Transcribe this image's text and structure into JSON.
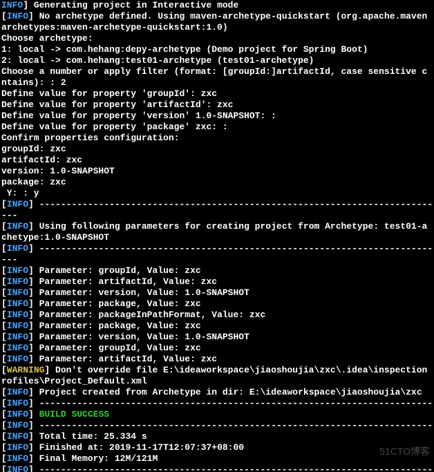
{
  "lines": [
    {
      "segments": [
        {
          "cls": "info",
          "text": "INFO"
        },
        {
          "cls": "white",
          "text": "] Generating project in Interactive mode"
        }
      ],
      "prefix": ""
    },
    {
      "segments": [
        {
          "cls": "white",
          "text": "["
        },
        {
          "cls": "info",
          "text": "INFO"
        },
        {
          "cls": "white",
          "text": "] No archetype defined. Using maven-archetype-quickstart (org.apache.maven"
        }
      ]
    },
    {
      "segments": [
        {
          "cls": "white",
          "text": "archetypes:maven-archetype-quickstart:1.0)"
        }
      ]
    },
    {
      "segments": [
        {
          "cls": "white",
          "text": "Choose archetype:"
        }
      ]
    },
    {
      "segments": [
        {
          "cls": "white",
          "text": "1: local -> com.hehang:depy-archetype (Demo project for Spring Boot)"
        }
      ]
    },
    {
      "segments": [
        {
          "cls": "white",
          "text": "2: local -> com.hehang:test01-archetype (test01-archetype)"
        }
      ]
    },
    {
      "segments": [
        {
          "cls": "white",
          "text": "Choose a number or apply filter (format: [groupId:]artifactId, case sensitive c"
        }
      ]
    },
    {
      "segments": [
        {
          "cls": "white",
          "text": "ntains): : 2"
        }
      ]
    },
    {
      "segments": [
        {
          "cls": "white",
          "text": "Define value for property 'groupId': zxc"
        }
      ]
    },
    {
      "segments": [
        {
          "cls": "white",
          "text": "Define value for property 'artifactId': zxc"
        }
      ]
    },
    {
      "segments": [
        {
          "cls": "white",
          "text": "Define value for property 'version' 1.0-SNAPSHOT: :"
        }
      ]
    },
    {
      "segments": [
        {
          "cls": "white",
          "text": "Define value for property 'package' zxc: :"
        }
      ]
    },
    {
      "segments": [
        {
          "cls": "white",
          "text": "Confirm properties configuration:"
        }
      ]
    },
    {
      "segments": [
        {
          "cls": "white",
          "text": "groupId: zxc"
        }
      ]
    },
    {
      "segments": [
        {
          "cls": "white",
          "text": "artifactId: zxc"
        }
      ]
    },
    {
      "segments": [
        {
          "cls": "white",
          "text": "version: 1.0-SNAPSHOT"
        }
      ]
    },
    {
      "segments": [
        {
          "cls": "white",
          "text": "package: zxc"
        }
      ]
    },
    {
      "segments": [
        {
          "cls": "white",
          "text": " Y: : y"
        }
      ]
    },
    {
      "segments": [
        {
          "cls": "white",
          "text": "["
        },
        {
          "cls": "info",
          "text": "INFO"
        },
        {
          "cls": "white",
          "text": "] -------------------------------------------------------------------------"
        }
      ]
    },
    {
      "segments": [
        {
          "cls": "white",
          "text": "---"
        }
      ]
    },
    {
      "segments": [
        {
          "cls": "white",
          "text": "["
        },
        {
          "cls": "info",
          "text": "INFO"
        },
        {
          "cls": "white",
          "text": "] Using following parameters for creating project from Archetype: test01-a"
        }
      ]
    },
    {
      "segments": [
        {
          "cls": "white",
          "text": "chetype:1.0-SNAPSHOT"
        }
      ]
    },
    {
      "segments": [
        {
          "cls": "white",
          "text": "["
        },
        {
          "cls": "info",
          "text": "INFO"
        },
        {
          "cls": "white",
          "text": "] -------------------------------------------------------------------------"
        }
      ]
    },
    {
      "segments": [
        {
          "cls": "white",
          "text": "---"
        }
      ]
    },
    {
      "segments": [
        {
          "cls": "white",
          "text": "["
        },
        {
          "cls": "info",
          "text": "INFO"
        },
        {
          "cls": "white",
          "text": "] Parameter: groupId, Value: zxc"
        }
      ]
    },
    {
      "segments": [
        {
          "cls": "white",
          "text": "["
        },
        {
          "cls": "info",
          "text": "INFO"
        },
        {
          "cls": "white",
          "text": "] Parameter: artifactId, Value: zxc"
        }
      ]
    },
    {
      "segments": [
        {
          "cls": "white",
          "text": "["
        },
        {
          "cls": "info",
          "text": "INFO"
        },
        {
          "cls": "white",
          "text": "] Parameter: version, Value: 1.0-SNAPSHOT"
        }
      ]
    },
    {
      "segments": [
        {
          "cls": "white",
          "text": "["
        },
        {
          "cls": "info",
          "text": "INFO"
        },
        {
          "cls": "white",
          "text": "] Parameter: package, Value: zxc"
        }
      ]
    },
    {
      "segments": [
        {
          "cls": "white",
          "text": "["
        },
        {
          "cls": "info",
          "text": "INFO"
        },
        {
          "cls": "white",
          "text": "] Parameter: packageInPathFormat, Value: zxc"
        }
      ]
    },
    {
      "segments": [
        {
          "cls": "white",
          "text": "["
        },
        {
          "cls": "info",
          "text": "INFO"
        },
        {
          "cls": "white",
          "text": "] Parameter: package, Value: zxc"
        }
      ]
    },
    {
      "segments": [
        {
          "cls": "white",
          "text": "["
        },
        {
          "cls": "info",
          "text": "INFO"
        },
        {
          "cls": "white",
          "text": "] Parameter: version, Value: 1.0-SNAPSHOT"
        }
      ]
    },
    {
      "segments": [
        {
          "cls": "white",
          "text": "["
        },
        {
          "cls": "info",
          "text": "INFO"
        },
        {
          "cls": "white",
          "text": "] Parameter: groupId, Value: zxc"
        }
      ]
    },
    {
      "segments": [
        {
          "cls": "white",
          "text": "["
        },
        {
          "cls": "info",
          "text": "INFO"
        },
        {
          "cls": "white",
          "text": "] Parameter: artifactId, Value: zxc"
        }
      ]
    },
    {
      "segments": [
        {
          "cls": "white",
          "text": "["
        },
        {
          "cls": "warn",
          "text": "WARNING"
        },
        {
          "cls": "white",
          "text": "] Don't override file E:\\ideaworkspace\\jiaoshoujia\\zxc\\.idea\\inspection"
        }
      ]
    },
    {
      "segments": [
        {
          "cls": "white",
          "text": "rofiles\\Project_Default.xml"
        }
      ]
    },
    {
      "segments": [
        {
          "cls": "white",
          "text": "["
        },
        {
          "cls": "info",
          "text": "INFO"
        },
        {
          "cls": "white",
          "text": "] Project created from Archetype in dir: E:\\ideaworkspace\\jiaoshoujia\\zxc"
        }
      ]
    },
    {
      "segments": [
        {
          "cls": "white",
          "text": "["
        },
        {
          "cls": "info",
          "text": "INFO"
        },
        {
          "cls": "white",
          "text": "] -------------------------------------------------------------------------"
        }
      ]
    },
    {
      "segments": [
        {
          "cls": "white",
          "text": "["
        },
        {
          "cls": "info",
          "text": "INFO"
        },
        {
          "cls": "white",
          "text": "] "
        },
        {
          "cls": "success",
          "text": "BUILD SUCCESS"
        }
      ]
    },
    {
      "segments": [
        {
          "cls": "white",
          "text": "["
        },
        {
          "cls": "info",
          "text": "INFO"
        },
        {
          "cls": "white",
          "text": "] -------------------------------------------------------------------------"
        }
      ]
    },
    {
      "segments": [
        {
          "cls": "white",
          "text": "["
        },
        {
          "cls": "info",
          "text": "INFO"
        },
        {
          "cls": "white",
          "text": "] Total time: 25.334 s"
        }
      ]
    },
    {
      "segments": [
        {
          "cls": "white",
          "text": "["
        },
        {
          "cls": "info",
          "text": "INFO"
        },
        {
          "cls": "white",
          "text": "] Finished at: 2019-11-17T12:07:37+08:00"
        }
      ]
    },
    {
      "segments": [
        {
          "cls": "white",
          "text": "["
        },
        {
          "cls": "info",
          "text": "INFO"
        },
        {
          "cls": "white",
          "text": "] Final Memory: 12M/121M"
        }
      ]
    },
    {
      "segments": [
        {
          "cls": "white",
          "text": "["
        },
        {
          "cls": "info",
          "text": "INFO"
        },
        {
          "cls": "white",
          "text": "] -------------------------------------------------------------------------"
        }
      ]
    }
  ],
  "watermark": "51CTO博客"
}
